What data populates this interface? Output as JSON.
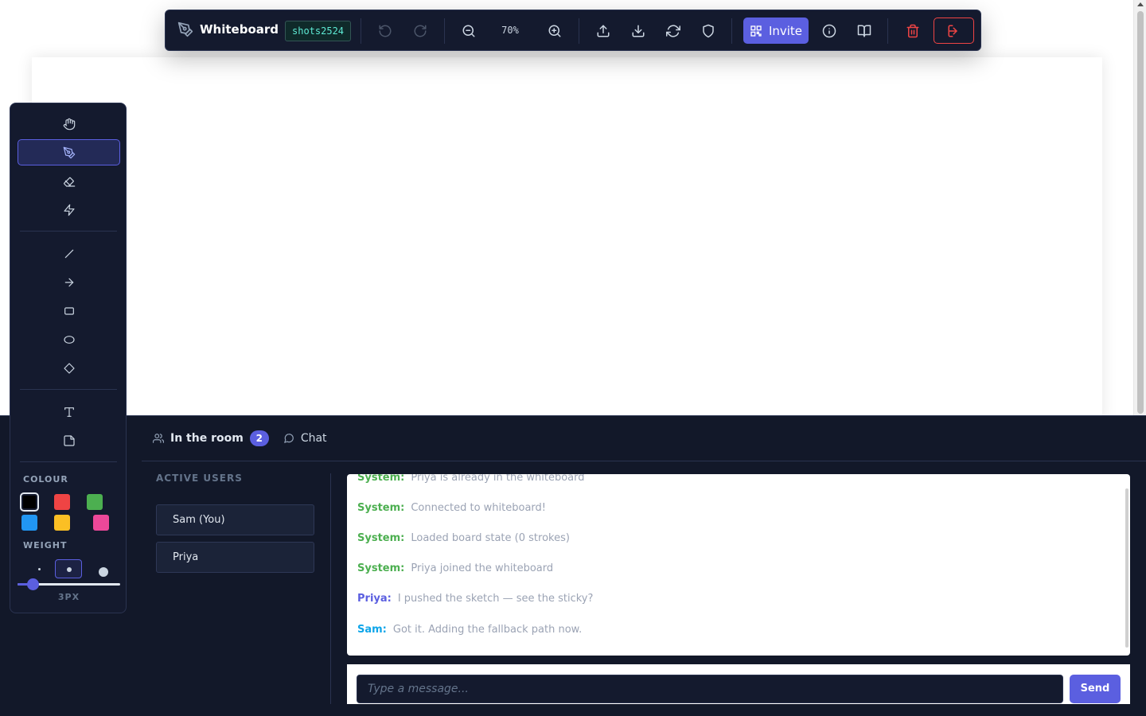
{
  "toolbar": {
    "app_title": "Whiteboard",
    "room_code": "shots2524",
    "zoom_level": "70%",
    "invite_label": "Invite",
    "icons": [
      "undo-icon",
      "redo-icon",
      "zoom-out-icon",
      "zoom-in-icon",
      "upload-icon",
      "download-icon",
      "refresh-icon",
      "shield-icon",
      "info-icon",
      "book-icon",
      "trash-icon",
      "logout-icon"
    ]
  },
  "tools": {
    "items": [
      "hand-tool",
      "pen-tool",
      "eraser-tool",
      "laser-tool",
      "line-tool",
      "arrow-tool",
      "rectangle-tool",
      "ellipse-tool",
      "diamond-tool",
      "text-tool",
      "sticky-note-tool"
    ],
    "active": "pen-tool",
    "colour_label": "COLOUR",
    "colours": [
      "#000000",
      "#ef4444",
      "#4caf50",
      "#2196f3",
      "#fbbf24",
      "#ec4899"
    ],
    "selected_colour": "#000000",
    "weight_label": "WEIGHT",
    "weight_value": "3PX",
    "weight_fraction": 0.15
  },
  "panel": {
    "tab_room": "In the room",
    "room_count": "2",
    "tab_chat": "Chat",
    "users_title": "ACTIVE USERS",
    "users": [
      "Sam (You)",
      "Priya"
    ]
  },
  "chat": {
    "colors": {
      "System": "#4caf50",
      "Priya": "#5b5fe0",
      "Sam": "#0ea5e9"
    },
    "messages": [
      {
        "author": "System:",
        "text": "Priya is already in the whiteboard"
      },
      {
        "author": "System:",
        "text": "Connected to whiteboard!"
      },
      {
        "author": "System:",
        "text": "Loaded board state (0 strokes)"
      },
      {
        "author": "System:",
        "text": "Priya joined the whiteboard"
      },
      {
        "author": "Priya:",
        "text": "I pushed the sketch — see the sticky?"
      },
      {
        "author": "Sam:",
        "text": "Got it. Adding the fallback path now."
      }
    ],
    "placeholder": "Type a message...",
    "send_label": "Send"
  }
}
